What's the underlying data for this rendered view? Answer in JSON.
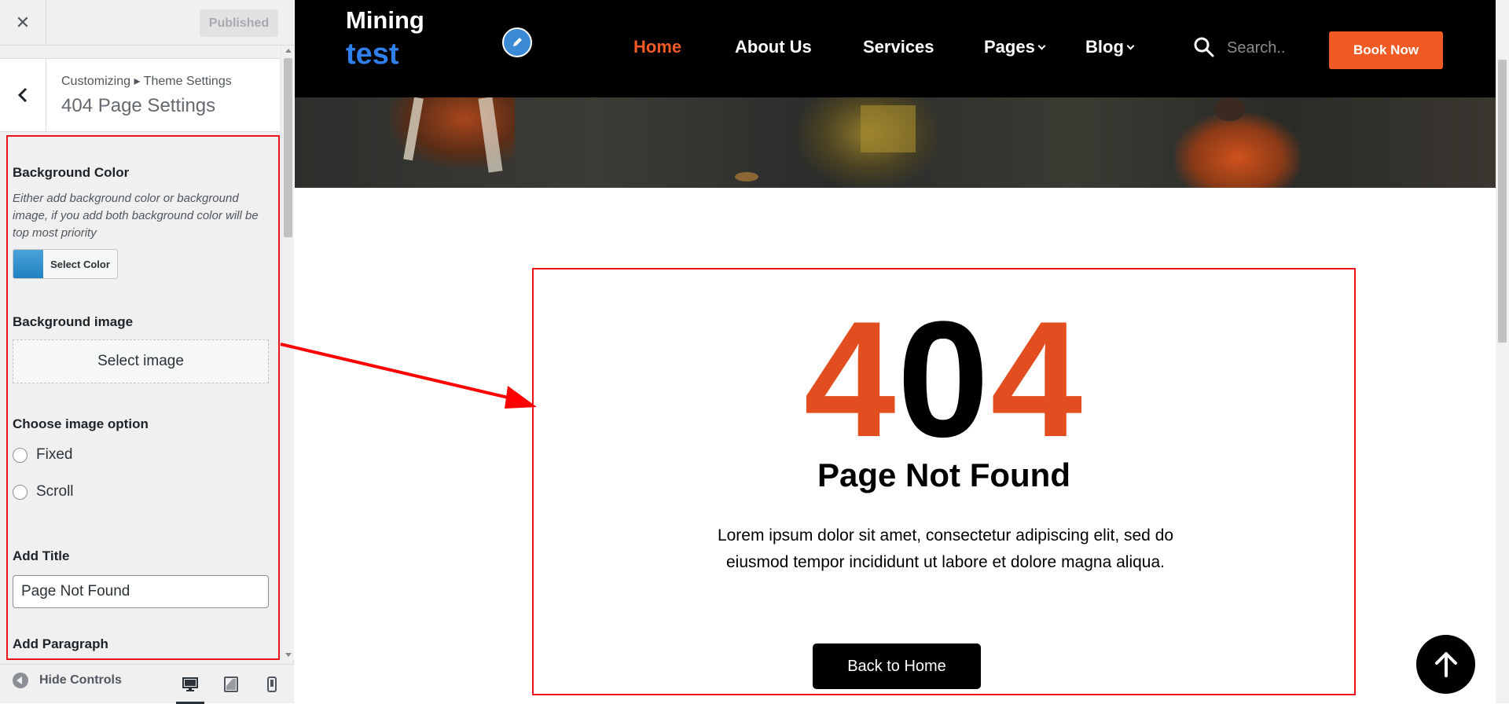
{
  "customizer": {
    "close_icon": "close-icon",
    "published_label": "Published",
    "breadcrumb": "Customizing ▸ Theme Settings",
    "section_title": "404 Page Settings",
    "background_color": {
      "title": "Background Color",
      "description": "Either add background color or background image, if you add both background color will be top most priority",
      "button_label": "Select Color",
      "swatch_color": "#2f8fcf"
    },
    "background_image": {
      "title": "Background image",
      "button_label": "Select image"
    },
    "image_option": {
      "title": "Choose image option",
      "options": [
        "Fixed",
        "Scroll"
      ]
    },
    "add_title": {
      "title": "Add Title",
      "value": "Page Not Found"
    },
    "add_paragraph": {
      "title": "Add Paragraph"
    },
    "footer": {
      "hide_controls_label": "Hide Controls",
      "devices": [
        "desktop",
        "tablet",
        "mobile"
      ]
    }
  },
  "site": {
    "logo_line1": "Mining",
    "logo_line2": "test",
    "nav": [
      "Home",
      "About Us",
      "Services",
      "Pages",
      "Blog"
    ],
    "active_nav": "Home",
    "search_placeholder": "Search..",
    "book_now_label": "Book Now",
    "brand_color": "#f15a24"
  },
  "not_found": {
    "code_digit_1": "4",
    "code_digit_2": "0",
    "code_digit_3": "4",
    "title": "Page Not Found",
    "paragraph": "Lorem ipsum dolor sit amet, consectetur adipiscing elit, sed do eiusmod tempor incididunt ut labore et dolore magna aliqua.",
    "button_label": "Back to Home"
  }
}
